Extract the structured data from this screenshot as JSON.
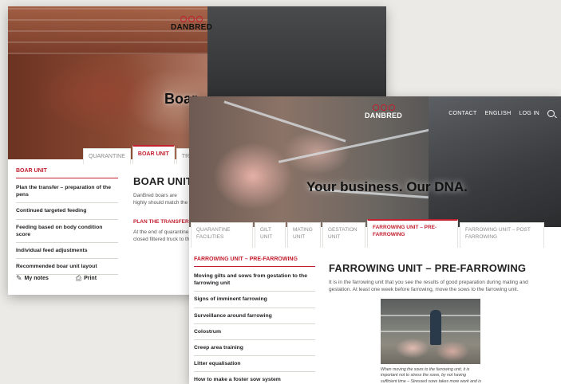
{
  "back_window": {
    "logo_text": "DANBRED",
    "hero_title": "Boar",
    "tabs": [
      "QUARANTINE",
      "BOAR UNIT",
      "TRAI"
    ],
    "sidebar": {
      "heading": "BOAR UNIT",
      "items": [
        "Plan the transfer – preparation of the pens",
        "Continued targeted feeding",
        "Feeding based on body condition score",
        "Individual feed adjustments",
        "Recommended boar unit layout"
      ]
    },
    "actions": {
      "notes": "My notes",
      "print": "Print"
    },
    "main": {
      "title": "BOAR UNIT",
      "intro": "DanBred boars are highly should match the quality",
      "section_heading": "PLAN THE TRANSFER",
      "section_text": "At the end of quarantine closed filtered truck to th"
    }
  },
  "front_window": {
    "logo_text": "DANBRED",
    "hero_title": "Your business. Our DNA.",
    "nav": [
      "CONTACT",
      "ENGLISH",
      "LOG IN"
    ],
    "tabs": [
      "QUARANTINE FACILITIES",
      "GILT UNIT",
      "MATING UNIT",
      "GESTATION UNIT",
      "FARROWING UNIT – PRE-FARROWING",
      "FARROWING UNIT – POST FARROWING"
    ],
    "sidebar": {
      "heading": "FARROWING UNIT – PRE-FARROWING",
      "items": [
        "Moving gilts and sows from gestation to the farrowing unit",
        "Signs of imminent farrowing",
        "Surveillance around farrowing",
        "Colostrum",
        "Creep area training",
        "Litter equalisation",
        "How to make a foster sow system"
      ]
    },
    "main": {
      "title": "FARROWING UNIT – PRE-FARROWING",
      "intro": "It is in the farrowing unit that you see the results of good preparation during mating and gestation. At least one week before farrowing, move the sows to the farrowing unit.",
      "caption": "When moving the sows to the farrowing unit, it is important not to stress the sows, by not having sufficient time – Stressed sows takes more work and is in high risk of reduced production results."
    }
  },
  "colors": {
    "accent": "#c3202f",
    "background": "#eceae6"
  }
}
